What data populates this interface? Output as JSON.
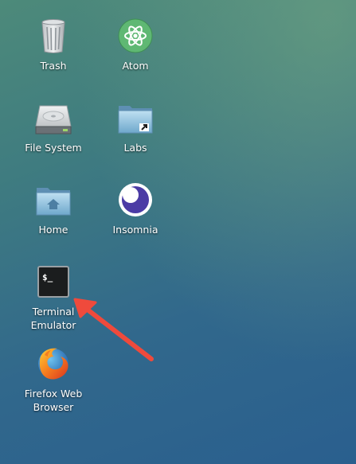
{
  "desktop": {
    "icons": [
      {
        "label": "Trash",
        "icon": "trash-icon"
      },
      {
        "label": "Atom",
        "icon": "atom-icon"
      },
      {
        "label": "File System",
        "icon": "hard-drive-icon"
      },
      {
        "label": "Labs",
        "icon": "folder-link-icon"
      },
      {
        "label": "Home",
        "icon": "home-folder-icon"
      },
      {
        "label": "Insomnia",
        "icon": "insomnia-icon"
      },
      {
        "label": "Terminal\nEmulator",
        "icon": "terminal-icon"
      },
      {
        "label": "Firefox Web\nBrowser",
        "icon": "firefox-icon"
      }
    ],
    "terminal_glyph": "$_"
  },
  "annotation": {
    "color": "#ef4a3c",
    "points_to": "Terminal Emulator"
  }
}
